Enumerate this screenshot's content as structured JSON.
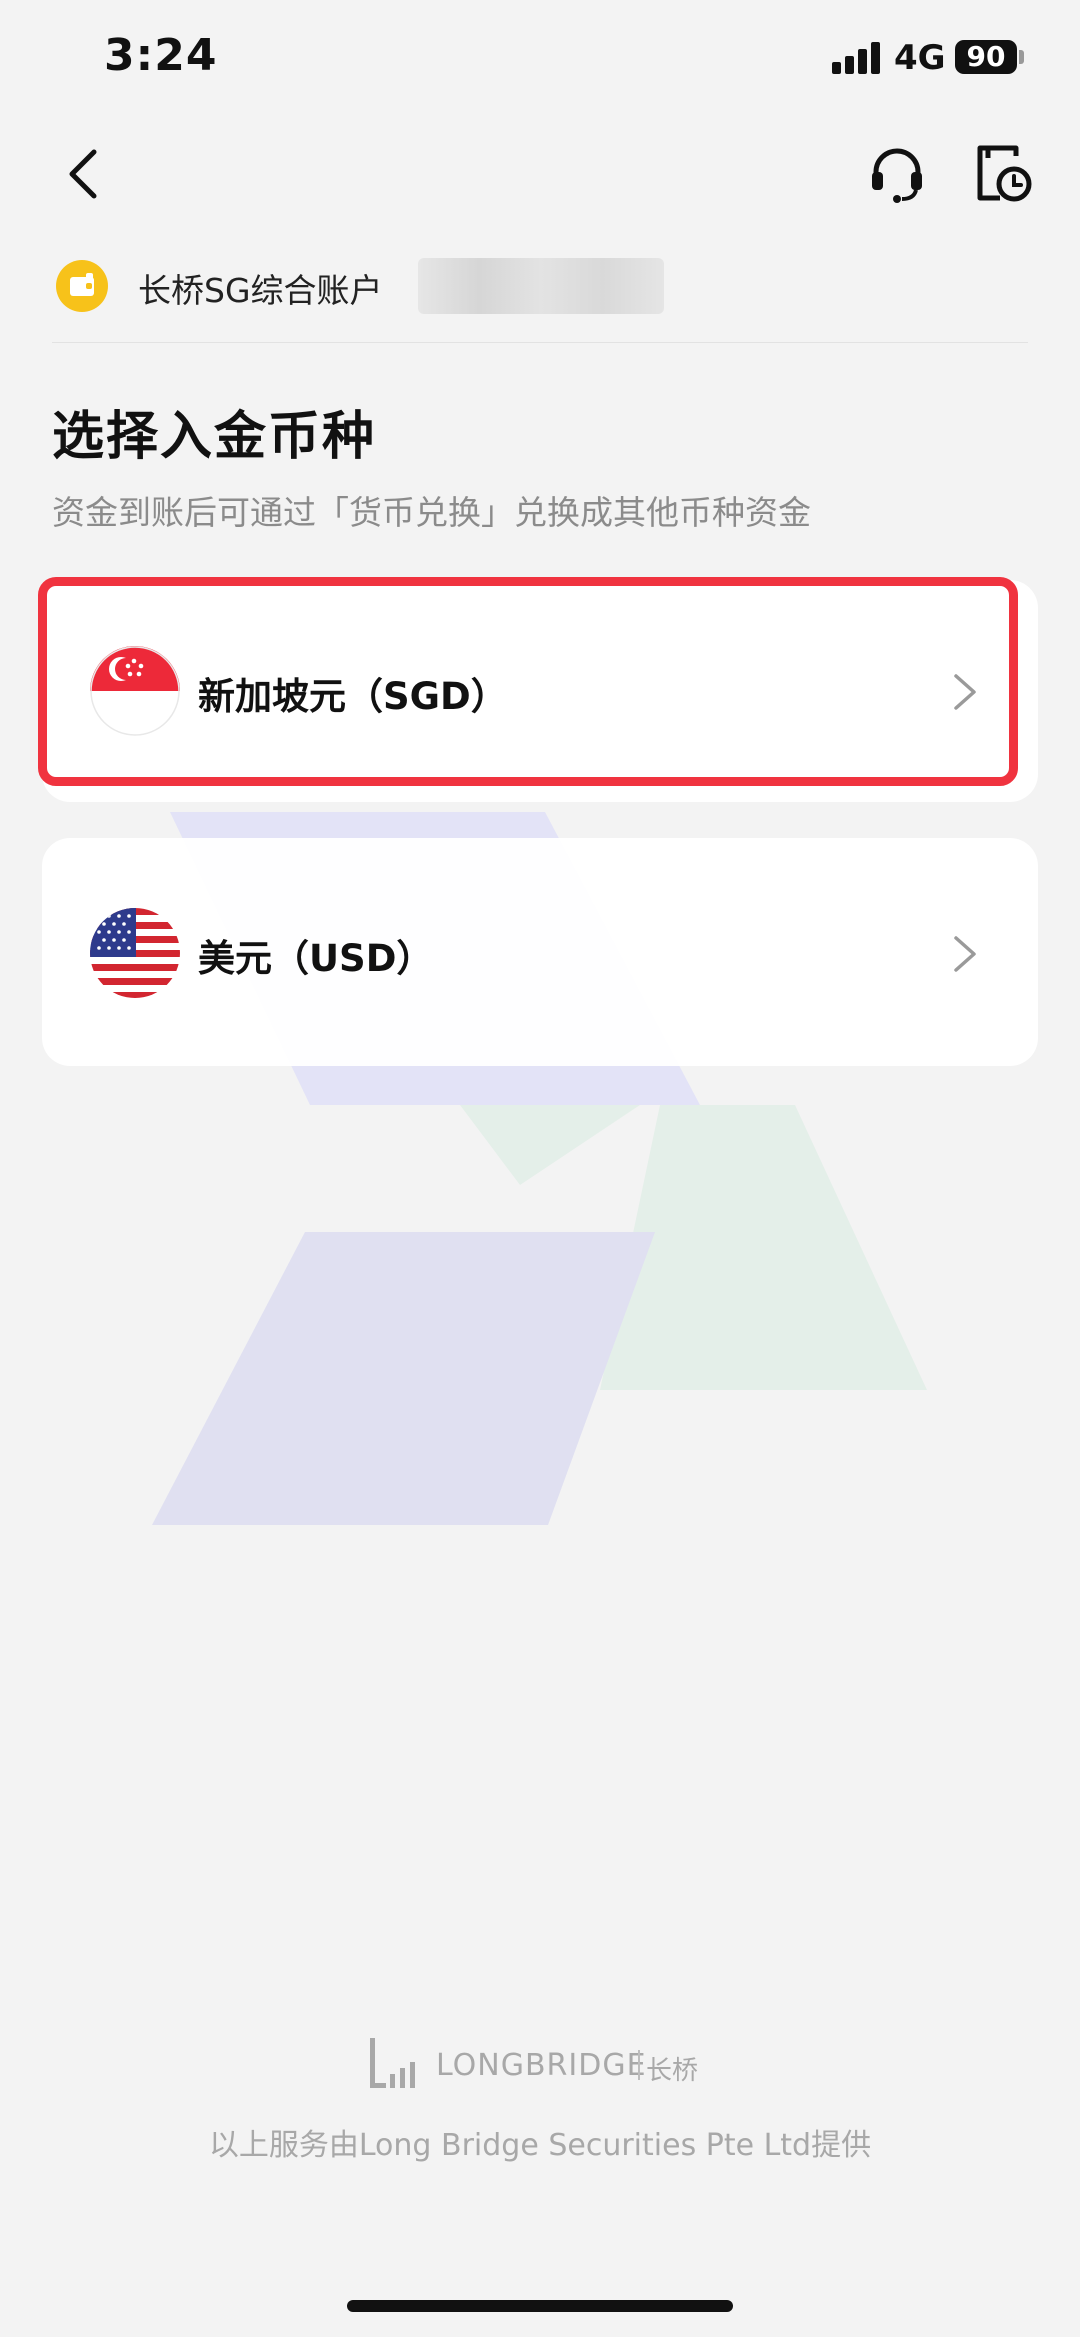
{
  "status_bar": {
    "time": "3:24",
    "network": "4G",
    "battery": "90"
  },
  "nav": {
    "back_icon": "back-arrow-icon",
    "support_icon": "headset-icon",
    "records_icon": "records-clock-icon"
  },
  "account": {
    "name": "长桥SG综合账户",
    "icon": "wallet-icon",
    "icon_color": "#f7c21a"
  },
  "page": {
    "title": "选择入金币种",
    "subtitle": "资金到账后可通过「货币兑换」兑换成其他币种资金"
  },
  "currencies": [
    {
      "label": "新加坡元（SGD）",
      "flag": "singapore-flag-icon",
      "selected": true
    },
    {
      "label": "美元（USD）",
      "flag": "usa-flag-icon",
      "selected": false
    }
  ],
  "highlight_color": "#f0333f",
  "footer": {
    "brand": "LONGBRIDGE",
    "brand_cn": "长桥",
    "text": "以上服务由Long Bridge Securities Pte Ltd提供"
  }
}
